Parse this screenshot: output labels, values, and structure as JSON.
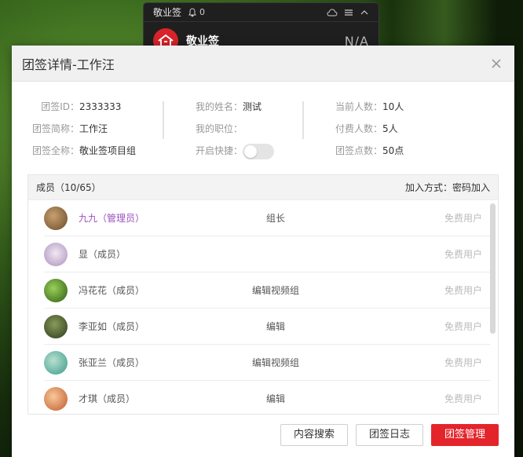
{
  "mini": {
    "title": "敬业签",
    "notif_count": "0",
    "name": "敬业签",
    "value": "N/A",
    "icons": [
      "bell-icon",
      "cloud-icon",
      "menu-icon",
      "chevron-up-icon"
    ]
  },
  "dialog": {
    "title": "团签详情-工作汪",
    "close_icon": "close-icon"
  },
  "info": {
    "group_id_label": "团签ID：",
    "group_id": "2333333",
    "short_name_label": "团签简称：",
    "short_name": "工作汪",
    "full_name_label": "团签全称：",
    "full_name": "敬业签项目组",
    "my_name_label": "我的姓名：",
    "my_name": "测试",
    "my_position_label": "我的职位：",
    "my_position": "",
    "shortcut_label": "开启快捷：",
    "shortcut_on": false,
    "current_count_label": "当前人数：",
    "current_count": "10人",
    "paid_count_label": "付费人数：",
    "paid_count": "5人",
    "points_label": "团签点数：",
    "points": "50点"
  },
  "members": {
    "header": "成员（10/65）",
    "join_method": "加入方式：密码加入",
    "rows": [
      {
        "name": "九九（管理员）",
        "role": "组长",
        "type": "免费用户",
        "admin": true,
        "avatar_color": "#8a6a4a"
      },
      {
        "name": "显（成员）",
        "role": "",
        "type": "免费用户",
        "admin": false,
        "avatar_color": "#c9b8d8"
      },
      {
        "name": "冯花花（成员）",
        "role": "编辑视频组",
        "type": "免费用户",
        "admin": false,
        "avatar_color": "#5a8a2a"
      },
      {
        "name": "李亚如（成员）",
        "role": "编辑",
        "type": "免费用户",
        "admin": false,
        "avatar_color": "#4a5a2a"
      },
      {
        "name": "张亚兰（成员）",
        "role": "编辑视频组",
        "type": "免费用户",
        "admin": false,
        "avatar_color": "#5ab0a0"
      },
      {
        "name": "才琪（成员）",
        "role": "编辑",
        "type": "免费用户",
        "admin": false,
        "avatar_color": "#e08a5a"
      }
    ]
  },
  "buttons": {
    "search": "内容搜索",
    "log": "团签日志",
    "manage": "团签管理"
  },
  "colors": {
    "accent": "#e4242b",
    "admin_name": "#9a50c0"
  }
}
